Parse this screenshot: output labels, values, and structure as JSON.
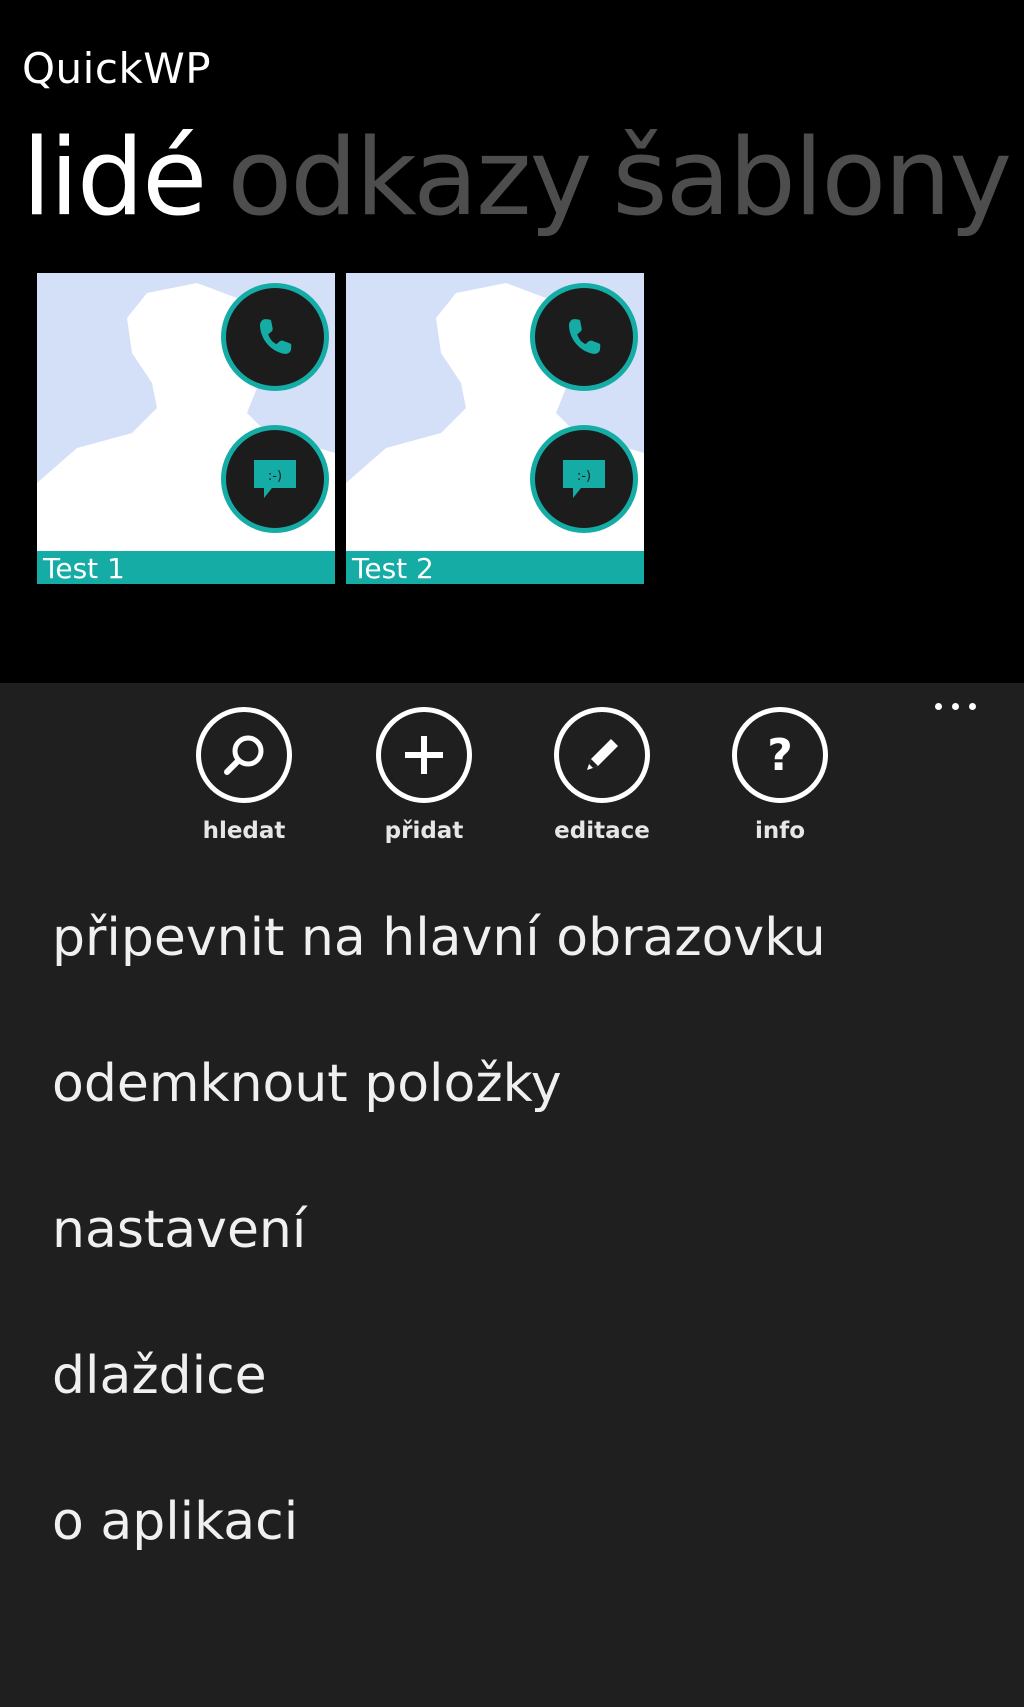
{
  "app": {
    "title": "QuickWP"
  },
  "pivot": {
    "items": [
      {
        "label": "lidé",
        "active": true
      },
      {
        "label": "odkazy",
        "active": false
      },
      {
        "label": "šablony",
        "active": false
      }
    ]
  },
  "tiles": [
    {
      "name": "Test 1",
      "actions": [
        "phone-icon",
        "message-icon"
      ]
    },
    {
      "name": "Test 2",
      "actions": [
        "phone-icon",
        "message-icon"
      ]
    }
  ],
  "appbar": {
    "buttons": [
      {
        "label": "hledat",
        "icon": "search-icon"
      },
      {
        "label": "přidat",
        "icon": "add-icon"
      },
      {
        "label": "editace",
        "icon": "edit-icon"
      },
      {
        "label": "info",
        "icon": "help-icon"
      }
    ],
    "menu_items": [
      "připevnit na hlavní obrazovku",
      "odemknout položky",
      "nastavení",
      "dlaždice",
      "o aplikaci"
    ]
  },
  "colors": {
    "accent": "#15aca6",
    "background": "#000000",
    "appbar_background": "#1f1f1f",
    "inactive_pivot": "#4d4d4d",
    "photo_background": "#d3e0f7"
  }
}
